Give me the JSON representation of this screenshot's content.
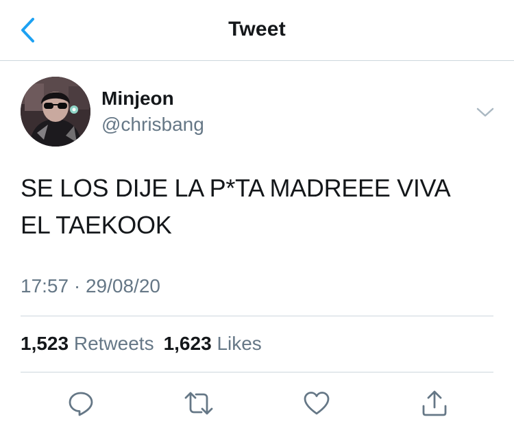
{
  "header": {
    "title": "Tweet",
    "back_icon": "chevron-left-icon"
  },
  "author": {
    "name": "Minjeon",
    "handle": "@chrisbang"
  },
  "tweet": {
    "text_lines": [
      "SE LOS DIJE LA P*TA MADREEE VIVA",
      "EL TAEKOOK"
    ],
    "time": "17:57",
    "separator": "·",
    "date": "29/08/20"
  },
  "stats": {
    "retweets_count": "1,523",
    "retweets_label": "Retweets",
    "likes_count": "1,623",
    "likes_label": "Likes"
  },
  "actions": [
    "reply-icon",
    "retweet-icon",
    "like-icon",
    "share-icon"
  ],
  "colors": {
    "accent": "#1da1f2",
    "text_primary": "#14171a",
    "text_secondary": "#657786",
    "icon": "#657786",
    "divider": "#ccd6dd"
  }
}
